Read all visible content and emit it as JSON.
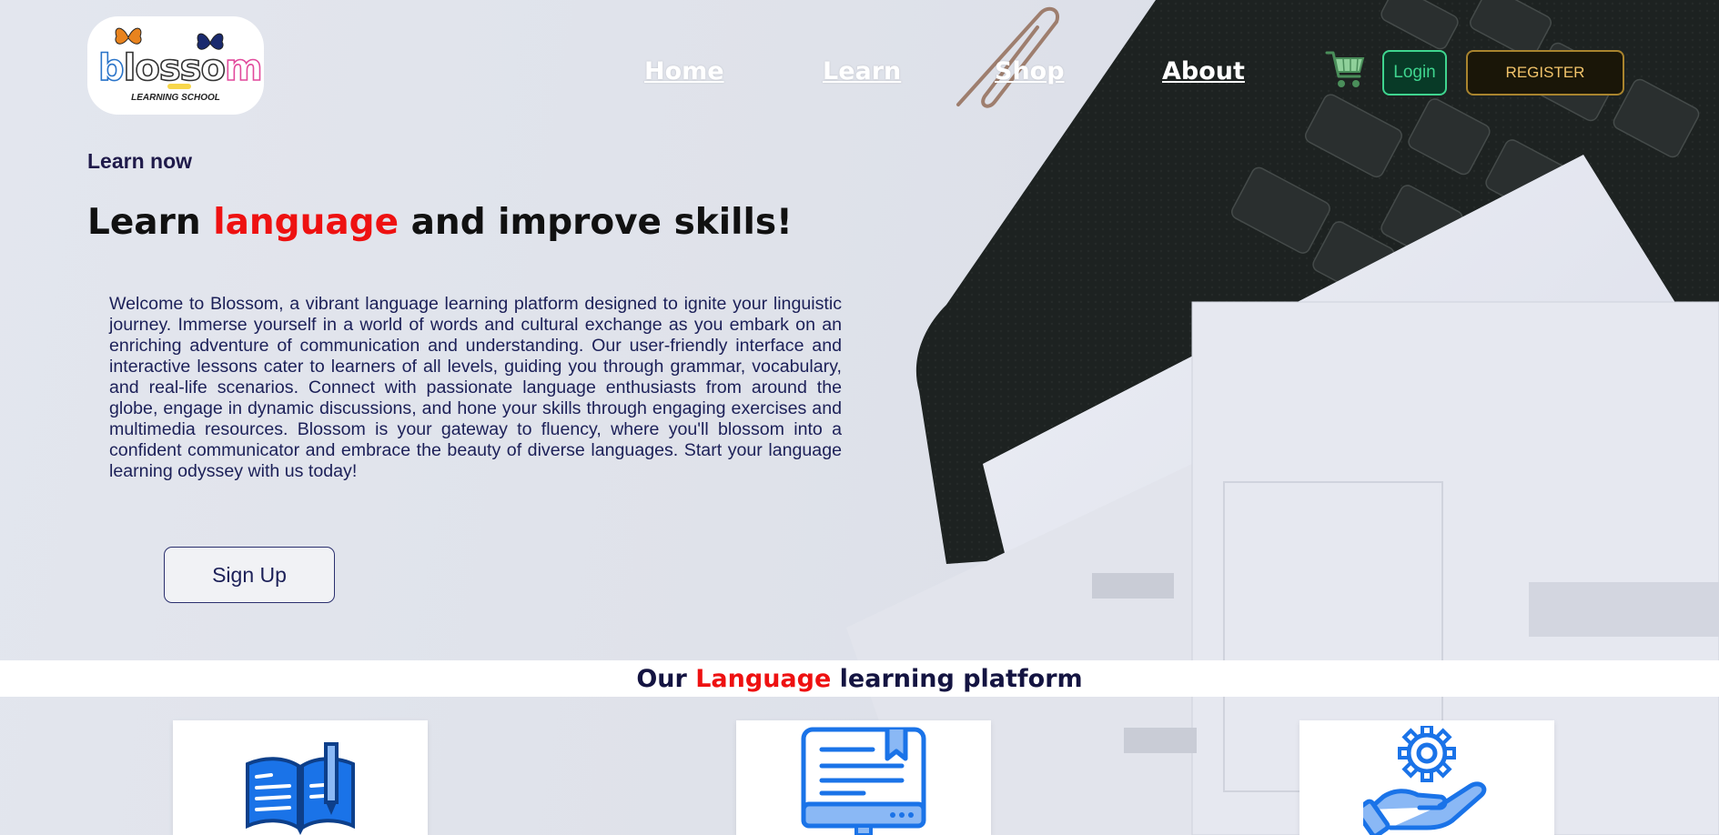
{
  "brand": {
    "logo_word_b": "b",
    "logo_word_l": "l",
    "logo_word_ossom": "osso",
    "logo_word_m": "m",
    "logo_subtitle": "LEARNING SCHOOL"
  },
  "nav": {
    "items": [
      {
        "label": "Home"
      },
      {
        "label": "Learn"
      },
      {
        "label": "Shop"
      },
      {
        "label": "About"
      }
    ]
  },
  "header_actions": {
    "cart_icon": "shopping-cart-icon",
    "login_label": "Login",
    "register_label": "REGISTER"
  },
  "hero": {
    "kicker": "Learn now",
    "title_before": "Learn ",
    "title_highlight": "language",
    "title_after": " and improve skills!",
    "body": "Welcome to Blossom, a vibrant language learning platform designed to ignite your linguistic journey. Immerse yourself in a world of words and cultural exchange as you embark on an enriching adventure of communication and understanding. Our user-friendly interface and interactive lessons cater to learners of all levels, guiding you through grammar, vocabulary, and real-life scenarios. Connect with passionate language enthusiasts from around the globe, engage in dynamic discussions, and hone your skills through engaging exercises and multimedia resources. Blossom is your gateway to fluency, where you'll blossom into a confident communicator and embrace the beauty of diverse languages. Start your language learning odyssey with us today!",
    "signup_label": "Sign Up"
  },
  "platform_section": {
    "title_before": "Our ",
    "title_highlight": "Language",
    "title_after": " learning platform",
    "cards": [
      {
        "icon": "open-book-pencil-icon"
      },
      {
        "icon": "computer-document-icon"
      },
      {
        "icon": "hand-gear-icon"
      }
    ]
  },
  "colors": {
    "accent_red": "#ee1111",
    "navy": "#141441",
    "login_green": "#3fd58f",
    "register_gold": "#a9842e",
    "icon_blue": "#1a73e8"
  }
}
